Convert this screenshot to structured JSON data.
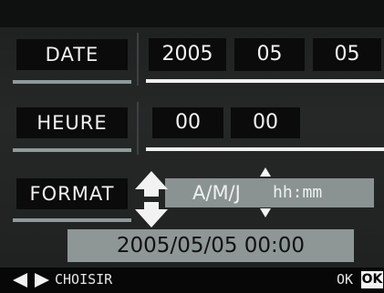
{
  "rows": {
    "date": {
      "label": "DATE",
      "year": "2005",
      "month": "05",
      "day": "05"
    },
    "time": {
      "label": "HEURE",
      "hour": "00",
      "minute": "00"
    },
    "format": {
      "label": "FORMAT",
      "date_part": "A/M/J",
      "time_part": "hh:mm"
    }
  },
  "preview": "2005/05/05 00:00",
  "footer": {
    "choose_label": "CHOISIR",
    "ok_label": "OK",
    "ok_key": "OK"
  },
  "colors": {
    "background": "#232525",
    "highlight": "#8e9696",
    "text": "#f2f2f2"
  }
}
